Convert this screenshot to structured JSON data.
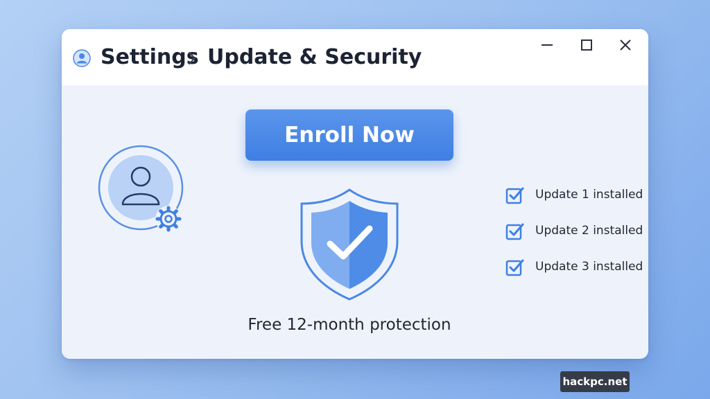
{
  "breadcrumb": {
    "root": "Settings",
    "separator_icon": "chevron-right-icon",
    "page": "Update & Security"
  },
  "window_controls": [
    "minimize-icon",
    "maximize-icon",
    "close-icon"
  ],
  "main": {
    "enroll_button_label": "Enroll Now",
    "protection_text": "Free 12-month protection",
    "updates": [
      {
        "label": "Update 1 installed",
        "checked": true
      },
      {
        "label": "Update 2 installed",
        "checked": true
      },
      {
        "label": "Update 3 installed",
        "checked": true
      }
    ]
  },
  "icons": {
    "app": "user-circle-icon",
    "avatar": "user-avatar-icon",
    "avatar_badge": "gear-icon",
    "shield": "shield-check-icon",
    "checkbox": "checkbox-checked-icon"
  },
  "watermark": "hackpc.net",
  "colors": {
    "accent": "#3f7fe3",
    "accent_light": "#5b95ec",
    "text": "#1c2333",
    "window_bg": "#eef3fb",
    "desktop_bg": "#9ec1f0"
  }
}
